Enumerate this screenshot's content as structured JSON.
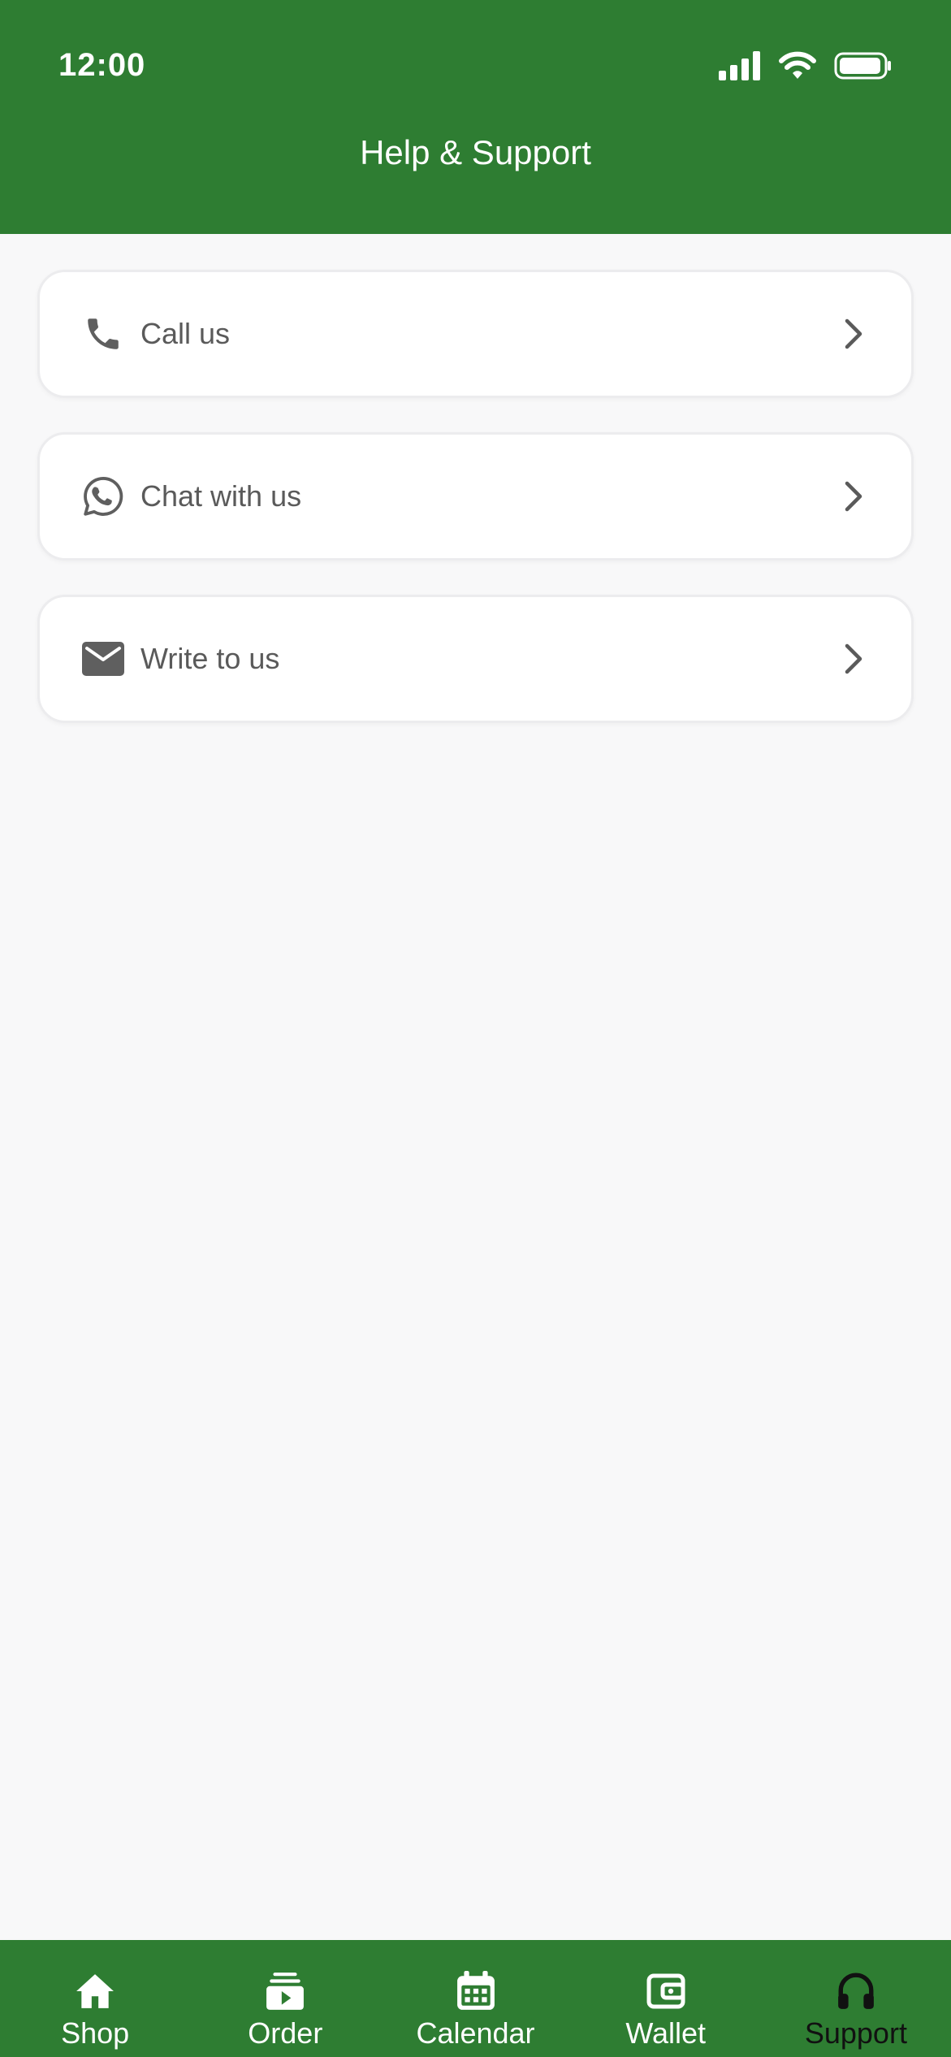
{
  "status_bar": {
    "time": "12:00",
    "icons": [
      "signal-icon",
      "wifi-icon",
      "battery-icon"
    ]
  },
  "header": {
    "title": "Help & Support",
    "background_color": "#2e7d32"
  },
  "support_options": [
    {
      "label": "Call us",
      "icon": "phone-icon"
    },
    {
      "label": "Chat with us",
      "icon": "whatsapp-icon"
    },
    {
      "label": "Write to us",
      "icon": "mail-icon"
    }
  ],
  "bottom_nav": {
    "items": [
      {
        "label": "Shop",
        "icon": "home-icon"
      },
      {
        "label": "Order",
        "icon": "order-icon"
      },
      {
        "label": "Calendar",
        "icon": "calendar-icon"
      },
      {
        "label": "Wallet",
        "icon": "wallet-icon"
      },
      {
        "label": "Support",
        "icon": "headphones-icon"
      }
    ],
    "active": "Support",
    "active_color": "#111111",
    "inactive_color": "#ffffff"
  }
}
